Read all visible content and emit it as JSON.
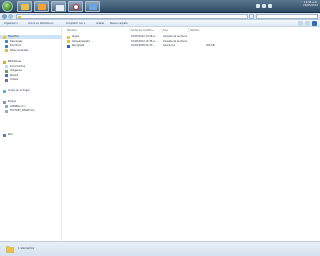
{
  "taskbar": {
    "apps": [
      {
        "name": "explorer",
        "icon": "folder-icon"
      },
      {
        "name": "media",
        "icon": "media-icon"
      },
      {
        "name": "windows",
        "icon": "window-icon"
      },
      {
        "name": "opera",
        "icon": "opera-icon"
      },
      {
        "name": "chat",
        "icon": "chat-icon"
      }
    ],
    "clock_time": "13:05 a.m.",
    "clock_date": "20/05/2012"
  },
  "toolbar": {
    "organize": "Organizar ▾",
    "include_library": "Incluir en biblioteca ▾",
    "share": "Compartir con ▾",
    "burn": "Grabar",
    "new_folder": "Nueva carpeta"
  },
  "sidebar": {
    "items": [
      {
        "label": "Favoritos",
        "icon": "star-icon"
      },
      {
        "label": "Descargas",
        "icon": "downloads-icon"
      },
      {
        "label": "Escritorio",
        "icon": "desktop-icon"
      },
      {
        "label": "Sitios recientes",
        "icon": "recent-icon"
      },
      {
        "label": "Bibliotecas",
        "icon": "library-icon"
      },
      {
        "label": "Documentos",
        "icon": "documents-icon"
      },
      {
        "label": "Imágenes",
        "icon": "pictures-icon"
      },
      {
        "label": "Música",
        "icon": "music-icon"
      },
      {
        "label": "Vídeos",
        "icon": "videos-icon"
      },
      {
        "label": "Grupo en el hogar",
        "icon": "homegroup-icon"
      },
      {
        "label": "Equipo",
        "icon": "computer-icon"
      },
      {
        "label": "COMPAQ (C:)",
        "icon": "drive-icon"
      },
      {
        "label": "FACTORY_IMAGE (D:)",
        "icon": "drive-icon"
      },
      {
        "label": "Red",
        "icon": "network-icon"
      }
    ]
  },
  "columns": {
    "name": "Nombre",
    "date": "Fecha de modifica...",
    "type": "Tipo",
    "size": "Tamaño"
  },
  "files": [
    {
      "name": "Skype",
      "date": "16/05/2012 10:38 a...",
      "type": "Carpeta de archivos",
      "size": ""
    },
    {
      "name": "Ableyarlegistro",
      "date": "16/05/2012 10:38 a...",
      "type": "Carpeta de archivos",
      "size": ""
    },
    {
      "name": "Recogleak",
      "date": "16/05/2008 02:30 ...",
      "type": "Aplicación",
      "size": "306 KB"
    }
  ],
  "status": {
    "count_text": "1 elementos"
  },
  "colors": {
    "folder": "#e8c14a",
    "selection": "#cfe3f8",
    "taskbar": "#2f4b63"
  }
}
